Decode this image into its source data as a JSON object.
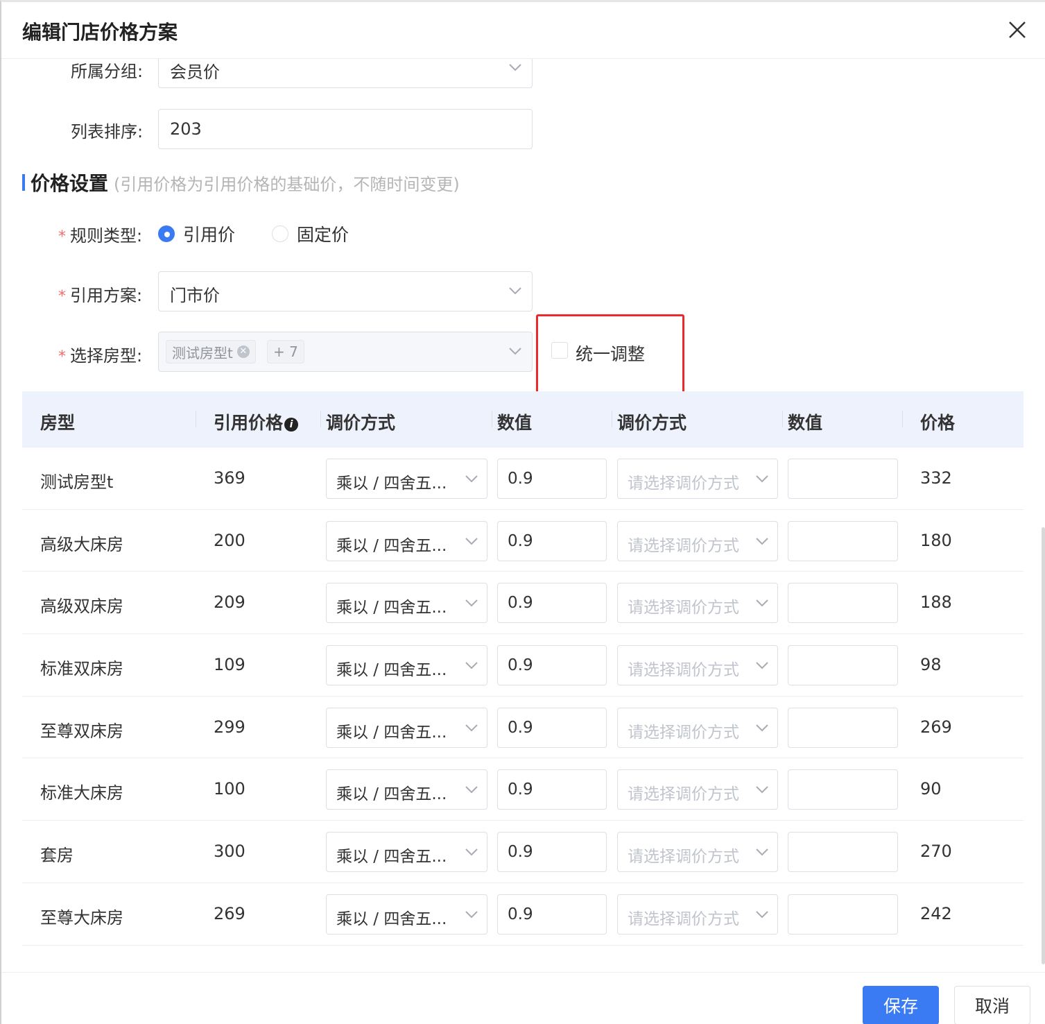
{
  "dialog": {
    "title": "编辑门店价格方案",
    "close_icon": "close-icon"
  },
  "form": {
    "group": {
      "label": "所属分组:",
      "value": "会员价"
    },
    "sort": {
      "label": "列表排序:",
      "value": "203"
    }
  },
  "price_section": {
    "title": "价格设置",
    "subtitle": "(引用价格为引用价格的基础价，不随时间变更)",
    "rule_type": {
      "required_mark": "*",
      "label": "规则类型:",
      "options": [
        "引用价",
        "固定价"
      ],
      "selected": "引用价"
    },
    "ref_plan": {
      "required_mark": "*",
      "label": "引用方案:",
      "value": "门市价"
    },
    "room_type": {
      "required_mark": "*",
      "label": "选择房型:",
      "tag": "测试房型t",
      "more": "+ 7"
    },
    "unify": {
      "label": "统一调整",
      "checked": false
    }
  },
  "table": {
    "headers": [
      "房型",
      "引用价格",
      "调价方式",
      "数值",
      "调价方式",
      "数值",
      "价格"
    ],
    "rows": [
      {
        "room": "测试房型t",
        "ref_price": "369",
        "method1": "乘以 / 四舍五...",
        "value1": "0.9",
        "method2_placeholder": "请选择调价方式",
        "value2": "",
        "price": "332"
      },
      {
        "room": "高级大床房",
        "ref_price": "200",
        "method1": "乘以 / 四舍五...",
        "value1": "0.9",
        "method2_placeholder": "请选择调价方式",
        "value2": "",
        "price": "180"
      },
      {
        "room": "高级双床房",
        "ref_price": "209",
        "method1": "乘以 / 四舍五...",
        "value1": "0.9",
        "method2_placeholder": "请选择调价方式",
        "value2": "",
        "price": "188"
      },
      {
        "room": "标准双床房",
        "ref_price": "109",
        "method1": "乘以 / 四舍五...",
        "value1": "0.9",
        "method2_placeholder": "请选择调价方式",
        "value2": "",
        "price": "98"
      },
      {
        "room": "至尊双床房",
        "ref_price": "299",
        "method1": "乘以 / 四舍五...",
        "value1": "0.9",
        "method2_placeholder": "请选择调价方式",
        "value2": "",
        "price": "269"
      },
      {
        "room": "标准大床房",
        "ref_price": "100",
        "method1": "乘以 / 四舍五...",
        "value1": "0.9",
        "method2_placeholder": "请选择调价方式",
        "value2": "",
        "price": "90"
      },
      {
        "room": "套房",
        "ref_price": "300",
        "method1": "乘以 / 四舍五...",
        "value1": "0.9",
        "method2_placeholder": "请选择调价方式",
        "value2": "",
        "price": "270"
      },
      {
        "room": "至尊大床房",
        "ref_price": "269",
        "method1": "乘以 / 四舍五...",
        "value1": "0.9",
        "method2_placeholder": "请选择调价方式",
        "value2": "",
        "price": "242"
      }
    ]
  },
  "footer": {
    "save": "保存",
    "cancel": "取消"
  },
  "colors": {
    "primary": "#3a7af2",
    "highlight_box": "#ec2a2a",
    "header_bg": "#eef2fc"
  }
}
